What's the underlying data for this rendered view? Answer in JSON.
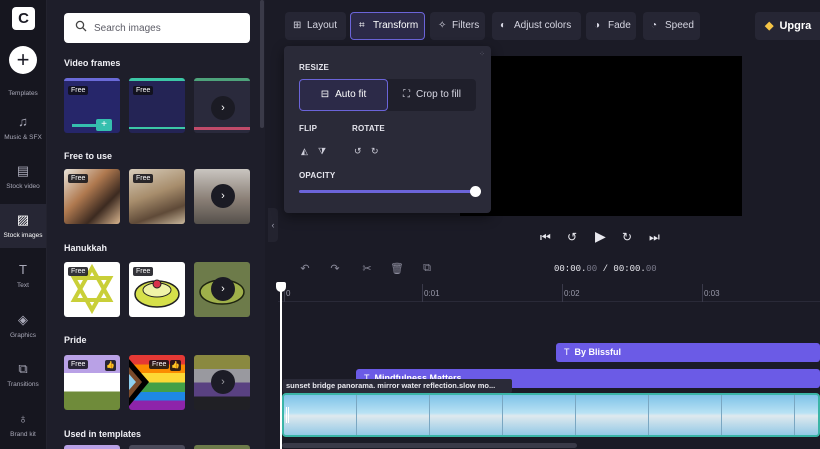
{
  "rail": {
    "logo": "C",
    "add": "+",
    "items": [
      {
        "label": "Templates",
        "icon": "templates-icon",
        "glyph": "▦"
      },
      {
        "label": "Music & SFX",
        "icon": "music-icon",
        "glyph": "♫"
      },
      {
        "label": "Stock video",
        "icon": "film-icon",
        "glyph": "▤"
      },
      {
        "label": "Stock images",
        "icon": "image-icon",
        "glyph": "▨"
      },
      {
        "label": "Text",
        "icon": "text-icon",
        "glyph": "T"
      },
      {
        "label": "Graphics",
        "icon": "shapes-icon",
        "glyph": "◈"
      },
      {
        "label": "Transitions",
        "icon": "transitions-icon",
        "glyph": "⧉"
      },
      {
        "label": "Brand kit",
        "icon": "brand-kit-icon",
        "glyph": "♁"
      }
    ]
  },
  "library": {
    "search_placeholder": "Search images",
    "sections": [
      {
        "title": "Video frames"
      },
      {
        "title": "Free to use"
      },
      {
        "title": "Hanukkah"
      },
      {
        "title": "Pride"
      },
      {
        "title": "Used in templates"
      }
    ],
    "badge_free": "Free",
    "like_glyph": "👍",
    "more_glyph": "›",
    "add_glyph": "+"
  },
  "toolbar": {
    "layout": "Layout",
    "transform": "Transform",
    "filters": "Filters",
    "adjust_colors": "Adjust colors",
    "fade": "Fade",
    "speed": "Speed",
    "upgrade": "Upgra"
  },
  "transform_panel": {
    "resize_label": "RESIZE",
    "auto_fit": "Auto fit",
    "crop_to_fill": "Crop to fill",
    "flip_label": "FLIP",
    "rotate_label": "ROTATE",
    "opacity_label": "OPACITY",
    "opacity_value": 1.0
  },
  "timeline": {
    "timecode_current": "00:00.",
    "timecode_current_frac": "00",
    "timecode_sep": " / ",
    "timecode_total": "00:00.",
    "timecode_total_frac": "00",
    "ruler": [
      "0",
      "0:01",
      "0:02",
      "0:03"
    ],
    "tracks": {
      "text_clip": "By Blissful",
      "text_clip_2": "Mindfulness Matters",
      "video_caption": "sunset bridge panorama. mirror water reflection.slow mo..."
    }
  },
  "colors": {
    "accent": "#6b64d9",
    "clip_purple": "#6b5be6",
    "clip_video": "#3bb5a7",
    "upgrade_gem": "#f5c446"
  }
}
